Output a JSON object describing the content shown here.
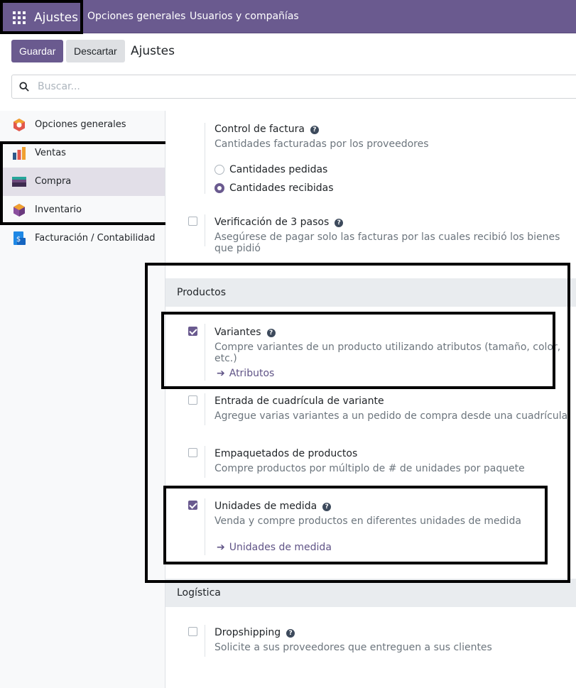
{
  "navbar": {
    "app_title": "Ajustes",
    "menu": [
      "Opciones generales",
      "Usuarios y compañías"
    ]
  },
  "control": {
    "save_label": "Guardar",
    "discard_label": "Descartar",
    "breadcrumb": "Ajustes"
  },
  "search": {
    "placeholder": "Buscar..."
  },
  "sidebar": {
    "items": [
      {
        "label": "Opciones generales",
        "icon": "settings-app-icon"
      },
      {
        "label": "Ventas",
        "icon": "sales-app-icon"
      },
      {
        "label": "Compra",
        "icon": "purchase-app-icon",
        "active": true
      },
      {
        "label": "Inventario",
        "icon": "inventory-app-icon"
      },
      {
        "label": "Facturación / Contabilidad",
        "icon": "accounting-app-icon"
      }
    ]
  },
  "billing": {
    "title": "Control de factura",
    "desc": "Cantidades facturadas por los proveedores",
    "options": [
      "Cantidades pedidas",
      "Cantidades recibidas"
    ],
    "selected": "Cantidades recibidas"
  },
  "three_way": {
    "title": "Verificación de 3 pasos",
    "desc": "Asegúrese de pagar solo las facturas por las cuales recibió los bienes que pidió",
    "checked": false
  },
  "products": {
    "header": "Productos",
    "variants": {
      "title": "Variantes",
      "desc": "Compre variantes de un producto utilizando atributos (tamaño, color, etc.)",
      "link": "Atributos",
      "checked": true
    },
    "grid_entry": {
      "title": "Entrada de cuadrícula de variante",
      "desc": "Agregue varias variantes a un pedido de compra desde una cuadrícula",
      "checked": false
    },
    "packagings": {
      "title": "Empaquetados de productos",
      "desc": "Compre productos por múltiplo de # de unidades por paquete",
      "checked": false
    },
    "uom": {
      "title": "Unidades de medida",
      "desc": "Venda y compre productos en diferentes unidades de medida",
      "link": "Unidades de medida",
      "checked": true
    }
  },
  "logistics": {
    "header": "Logística",
    "dropship": {
      "title": "Dropshipping",
      "desc": "Solicite a sus proveedores que entreguen a sus clientes",
      "checked": false
    }
  },
  "colors": {
    "brand": "#6a5a8f",
    "link": "#5f5386"
  }
}
